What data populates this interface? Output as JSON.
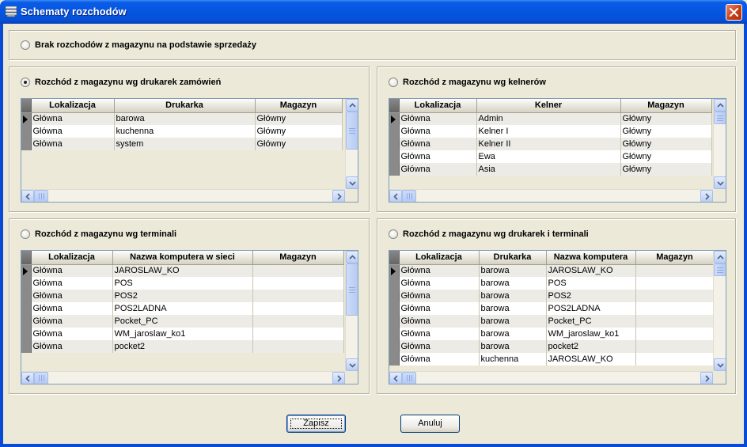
{
  "window": {
    "title": "Schematy rozchodów"
  },
  "options": {
    "none": "Brak rozchodów z magazynu na podstawie sprzedaży",
    "printers": "Rozchód z magazynu wg drukarek zamówień",
    "waiters": "Rozchód z magazynu wg kelnerów",
    "terminals": "Rozchód z magazynu wg terminali",
    "printers_terminals": "Rozchód z magazynu wg drukarek i terminali"
  },
  "selected_option": "printers",
  "grids": {
    "printers": {
      "columns": [
        "Lokalizacja",
        "Drukarka",
        "Magazyn"
      ],
      "rows": [
        [
          "Główna",
          "barowa",
          "Główny"
        ],
        [
          "Główna",
          "kuchenna",
          "Główny"
        ],
        [
          "Główna",
          "system",
          "Główny"
        ]
      ]
    },
    "waiters": {
      "columns": [
        "Lokalizacja",
        "Kelner",
        "Magazyn"
      ],
      "rows": [
        [
          "Główna",
          "Admin",
          "Główny"
        ],
        [
          "Główna",
          "Kelner I",
          "Główny"
        ],
        [
          "Główna",
          "Kelner II",
          "Główny"
        ],
        [
          "Główna",
          "Ewa",
          "Główny"
        ],
        [
          "Główna",
          "Asia",
          "Główny"
        ]
      ]
    },
    "terminals": {
      "columns": [
        "Lokalizacja",
        "Nazwa komputera w sieci",
        "Magazyn"
      ],
      "rows": [
        [
          "Główna",
          "JAROSLAW_KO",
          ""
        ],
        [
          "Główna",
          "POS",
          ""
        ],
        [
          "Główna",
          "POS2",
          ""
        ],
        [
          "Główna",
          "POS2LADNA",
          ""
        ],
        [
          "Główna",
          "Pocket_PC",
          ""
        ],
        [
          "Główna",
          "WM_jaroslaw_ko1",
          ""
        ],
        [
          "Główna",
          "pocket2",
          ""
        ]
      ]
    },
    "printers_terminals": {
      "columns": [
        "Lokalizacja",
        "Drukarka",
        "Nazwa komputera",
        "Magazyn"
      ],
      "rows": [
        [
          "Główna",
          "barowa",
          "JAROSLAW_KO",
          ""
        ],
        [
          "Główna",
          "barowa",
          "POS",
          ""
        ],
        [
          "Główna",
          "barowa",
          "POS2",
          ""
        ],
        [
          "Główna",
          "barowa",
          "POS2LADNA",
          ""
        ],
        [
          "Główna",
          "barowa",
          "Pocket_PC",
          ""
        ],
        [
          "Główna",
          "barowa",
          "WM_jaroslaw_ko1",
          ""
        ],
        [
          "Główna",
          "barowa",
          "pocket2",
          ""
        ],
        [
          "Główna",
          "kuchenna",
          "JAROSLAW_KO",
          ""
        ]
      ]
    }
  },
  "buttons": {
    "save": "Zapisz",
    "cancel": "Anuluj"
  }
}
